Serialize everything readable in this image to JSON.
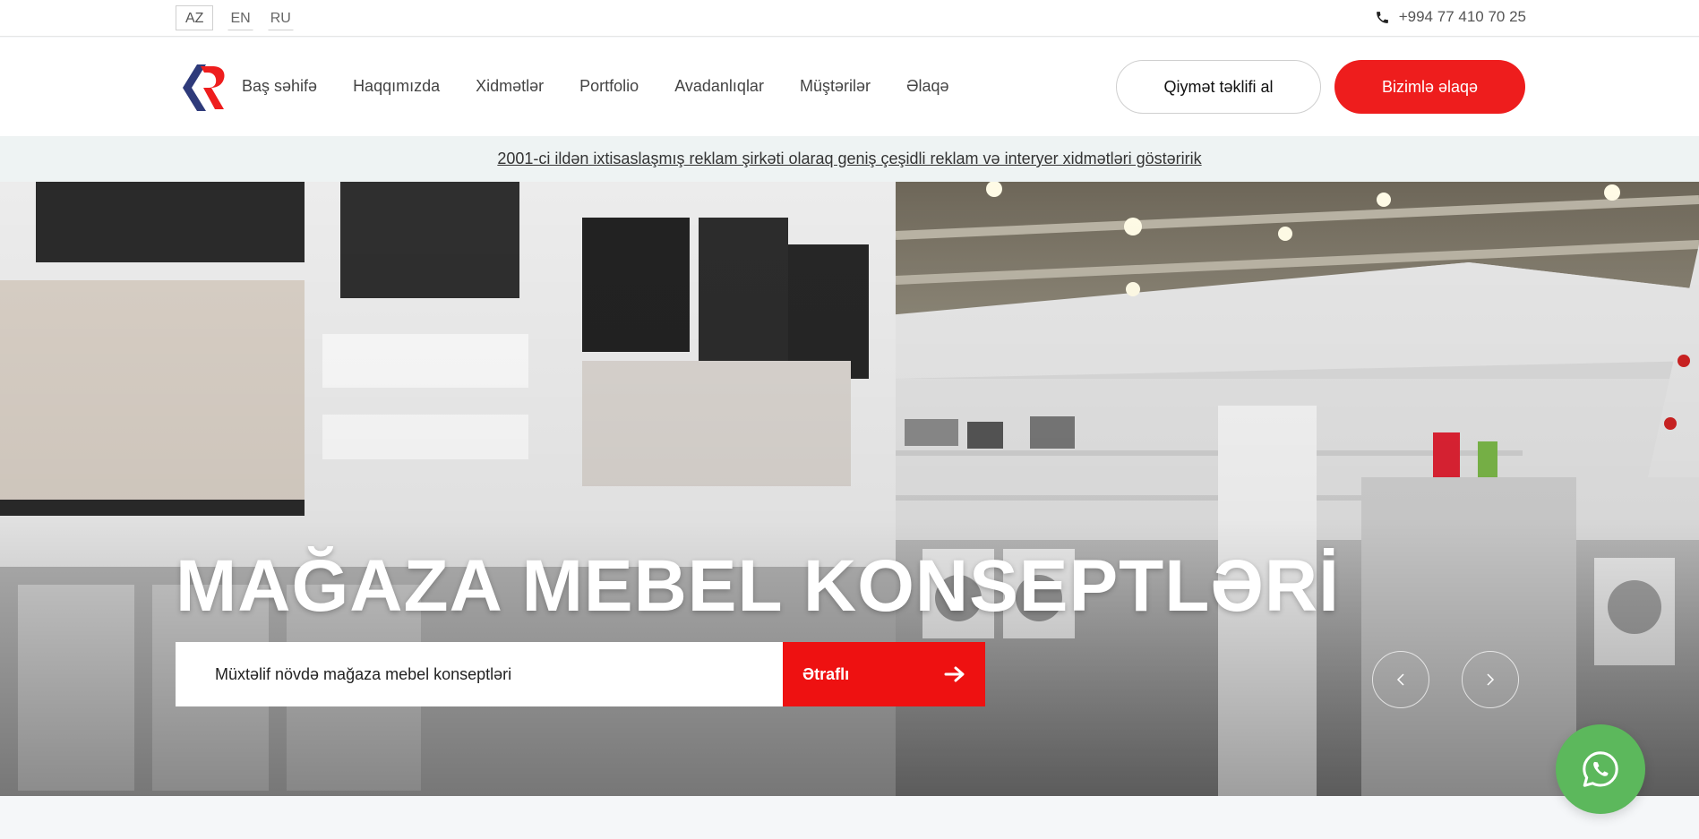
{
  "languages": [
    {
      "label": "AZ",
      "active": true
    },
    {
      "label": "EN",
      "active": false
    },
    {
      "label": "RU",
      "active": false
    }
  ],
  "contact": {
    "phone": "+994 77 410 70 25",
    "icon": "phone-icon"
  },
  "nav": {
    "items": [
      {
        "label": "Baş səhifə"
      },
      {
        "label": "Haqqımızda"
      },
      {
        "label": "Xidmətlər"
      },
      {
        "label": "Portfolio"
      },
      {
        "label": "Avadanlıqlar"
      },
      {
        "label": "Müştərilər"
      },
      {
        "label": "Əlaqə"
      }
    ],
    "quote_button": "Qiymət təklifi al",
    "contact_button": "Bizimlə əlaqə"
  },
  "announcement": "2001-ci ildən ixtisaslaşmış reklam şirkəti olaraq geniş çeşidli reklam və interyer xidmətləri göstəririk",
  "hero": {
    "title": "MAĞAZA MEBEL KONSEPTLƏRİ",
    "subtitle": "Müxtəlif növdə mağaza mebel konseptləri",
    "more_button": "Ətraflı"
  },
  "colors": {
    "accent": "#ee1d1d",
    "whatsapp": "#5cb85c",
    "logo_blue": "#2e3a7a"
  }
}
